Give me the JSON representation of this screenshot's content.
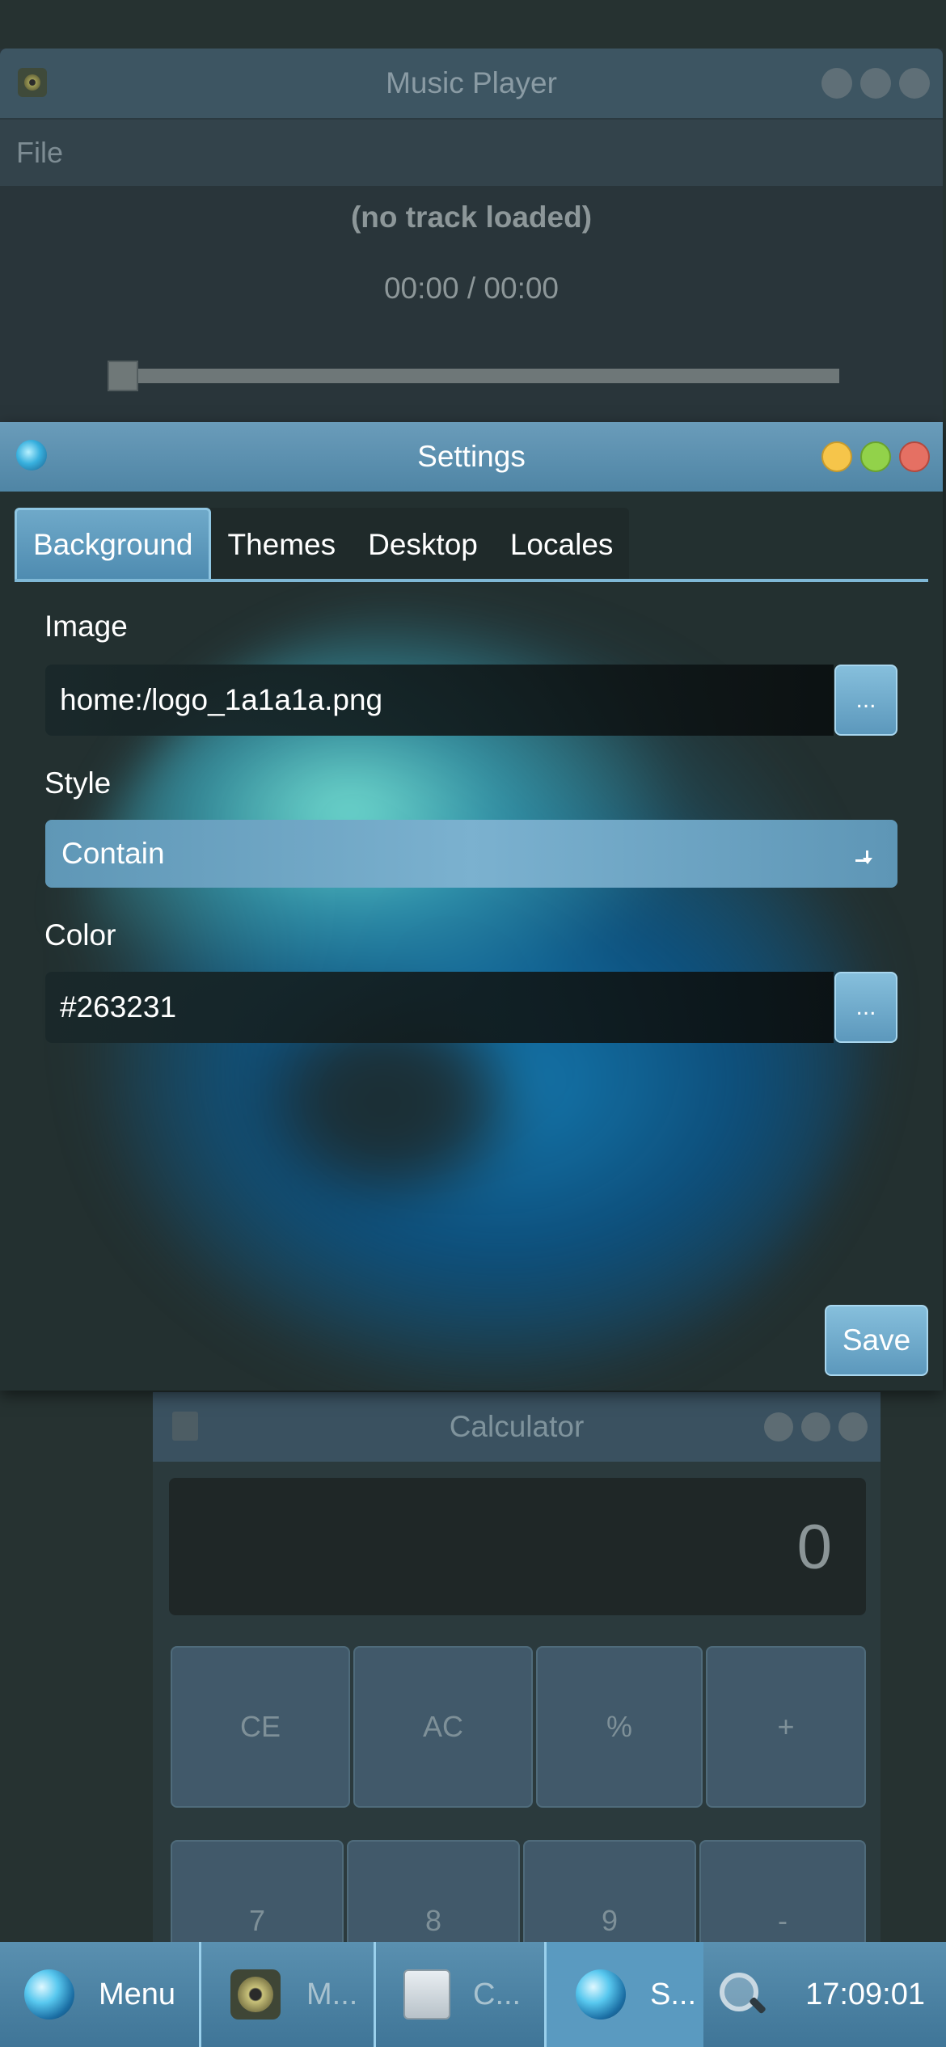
{
  "music_player": {
    "title": "Music Player",
    "menu_file": "File",
    "track": "(no track loaded)",
    "time": "00:00 / 00:00",
    "progress": 0
  },
  "settings": {
    "title": "Settings",
    "tabs": [
      "Background",
      "Themes",
      "Desktop",
      "Locales"
    ],
    "active_tab": "Background",
    "image_label": "Image",
    "image_value": "home:/logo_1a1a1a.png",
    "browse_label": "...",
    "style_label": "Style",
    "style_value": "Contain",
    "color_label": "Color",
    "color_value": "#263231",
    "save_label": "Save"
  },
  "calculator": {
    "title": "Calculator",
    "display": "0",
    "row1": [
      "CE",
      "AC",
      "%",
      "+"
    ],
    "row2": [
      "7",
      "8",
      "9",
      "-"
    ]
  },
  "taskbar": {
    "menu_label": "Menu",
    "music_label": "M...",
    "calc_label": "C...",
    "settings_label": "S...",
    "clock": "17:09:01"
  },
  "colors": {
    "desktop_bg": "#263231",
    "accent": "#5a9ac0",
    "close": "#e57063",
    "maximize": "#92d24a",
    "minimize": "#f6c54a"
  }
}
